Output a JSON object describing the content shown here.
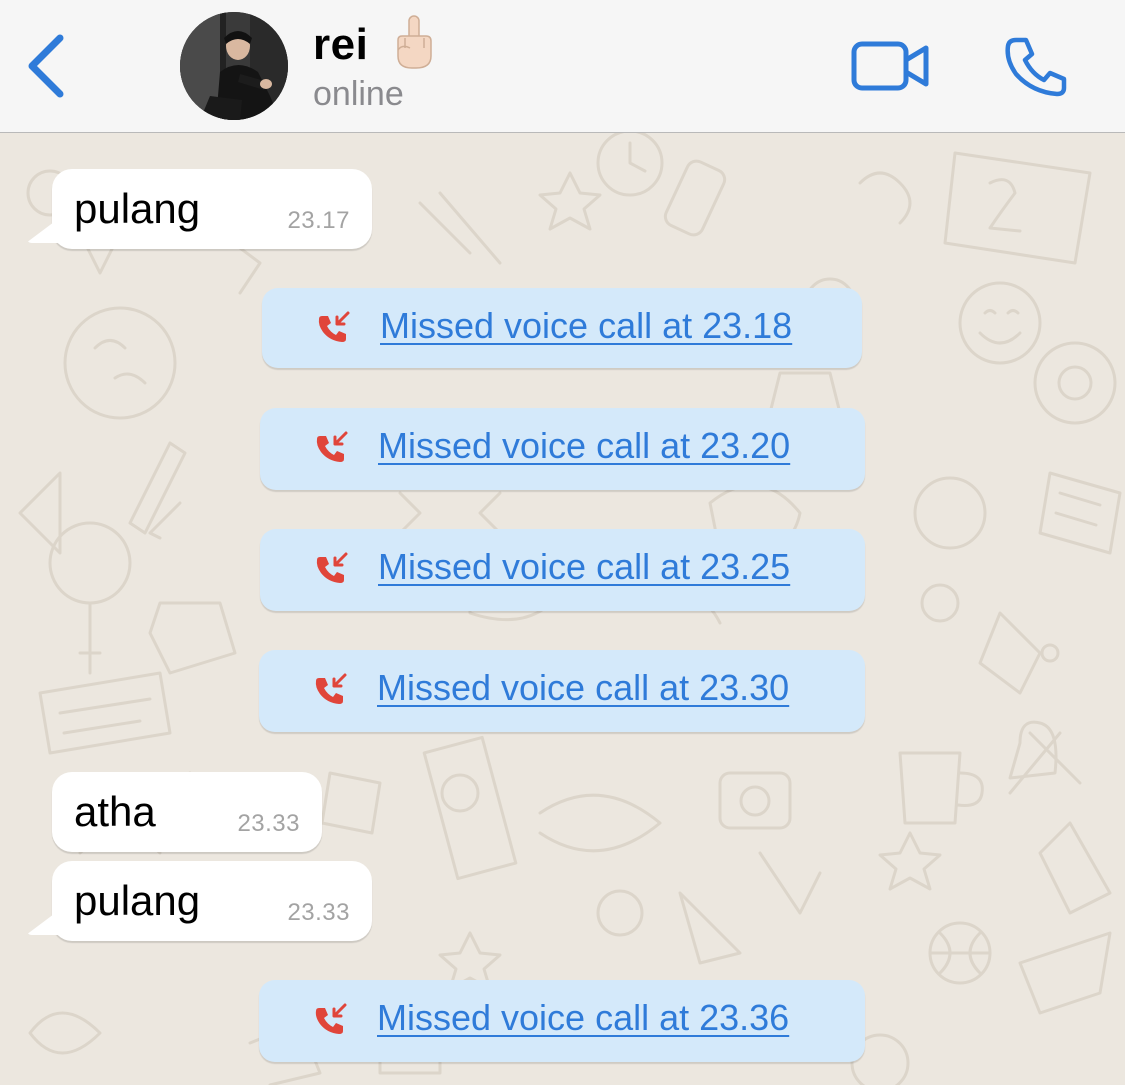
{
  "header": {
    "contact_name": "rei",
    "status": "online",
    "emoji": "🖕🏻"
  },
  "colors": {
    "accent": "#2f7bd9",
    "missed_call_icon": "#e0453a",
    "call_bubble": "#d4e9fa",
    "incoming_bubble": "#ffffff",
    "wallpaper": "#ece7df"
  },
  "messages": [
    {
      "type": "text",
      "text": "pulang",
      "time": "23.17"
    },
    {
      "type": "missed_call",
      "text": "Missed voice call at 23.18"
    },
    {
      "type": "missed_call",
      "text": "Missed voice call at 23.20"
    },
    {
      "type": "missed_call",
      "text": "Missed voice call at 23.25"
    },
    {
      "type": "missed_call",
      "text": "Missed voice call at 23.30"
    },
    {
      "type": "text",
      "text": "atha",
      "time": "23.33"
    },
    {
      "type": "text",
      "text": "pulang",
      "time": "23.33"
    },
    {
      "type": "missed_call",
      "text": "Missed voice call at 23.36"
    }
  ],
  "icons": {
    "back": "chevron-left-icon",
    "video": "video-camera-icon",
    "phone": "phone-icon",
    "missed_call": "missed-call-icon"
  }
}
